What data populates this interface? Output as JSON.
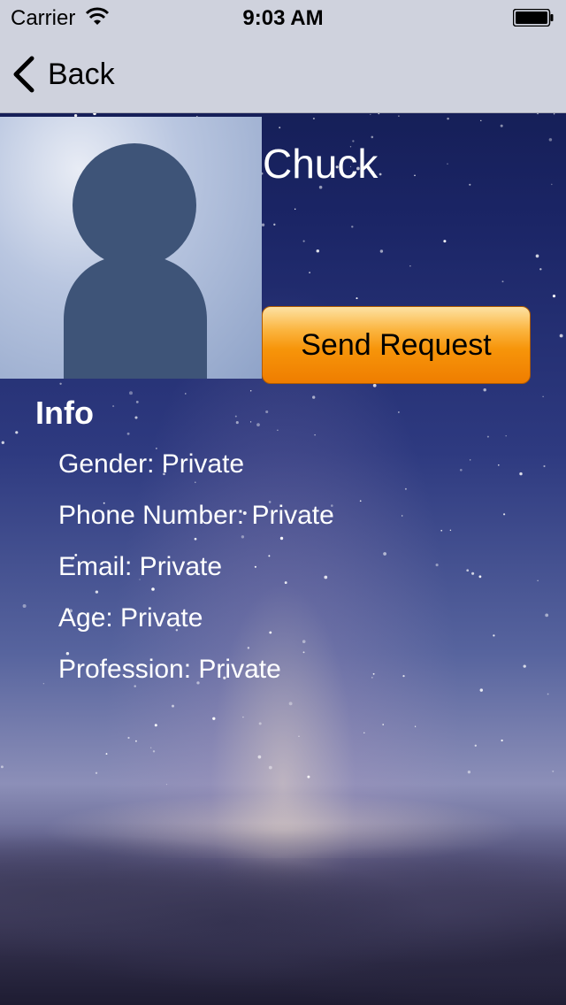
{
  "status_bar": {
    "carrier": "Carrier",
    "time": "9:03 AM"
  },
  "nav": {
    "back_label": "Back"
  },
  "profile": {
    "name": "Chuck",
    "send_request_label": "Send Request"
  },
  "info": {
    "heading": "Info",
    "items": [
      "Gender: Private",
      "Phone Number: Private",
      "Email: Private",
      "Age: Private",
      "Profession: Private"
    ]
  },
  "colors": {
    "button_orange": "#f7950a",
    "nav_background": "#cfd2dd",
    "avatar_silhouette": "#3e5478"
  },
  "icons": [
    "wifi-icon",
    "battery-icon",
    "back-chevron-icon",
    "person-silhouette-icon"
  ]
}
